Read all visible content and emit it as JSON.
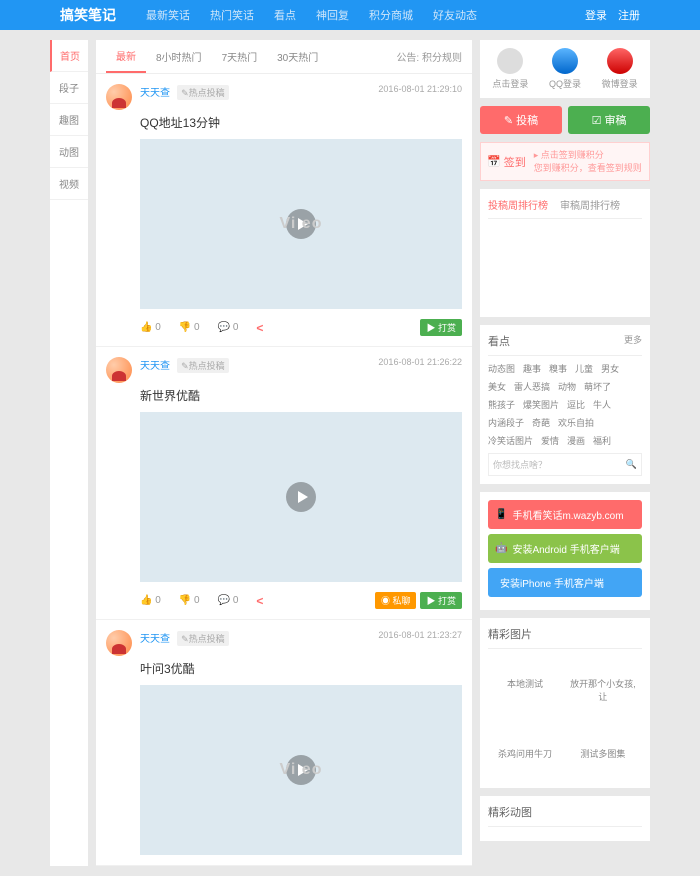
{
  "header": {
    "logo": "搞笑笔记",
    "nav": [
      "最新笑话",
      "热门笑话",
      "看点",
      "神回复",
      "积分商城",
      "好友动态"
    ],
    "login": "登录",
    "register": "注册"
  },
  "leftTabs": [
    "首页",
    "段子",
    "趣图",
    "动图",
    "视频"
  ],
  "topTabs": {
    "items": [
      "最新",
      "8小时热门",
      "7天热门",
      "30天热门"
    ],
    "noticeLabel": "公告:",
    "noticeText": "积分规则"
  },
  "posts": [
    {
      "user": "天天查",
      "tag": "✎热点投稿",
      "time": "2016-08-01 21:29:10",
      "title": "QQ地址13分钟",
      "like": "0",
      "dislike": "0",
      "comment": "0",
      "videoText": "Vi  eo",
      "buttons": [
        {
          "cls": "btn-green",
          "icon": "▶",
          "label": "打赏"
        }
      ]
    },
    {
      "user": "天天查",
      "tag": "✎热点投稿",
      "time": "2016-08-01 21:26:22",
      "title": "新世界优酷",
      "like": "0",
      "dislike": "0",
      "comment": "0",
      "videoText": "",
      "buttons": [
        {
          "cls": "btn-orange",
          "icon": "◉",
          "label": "私聊"
        },
        {
          "cls": "btn-green",
          "icon": "▶",
          "label": "打赏"
        }
      ]
    },
    {
      "user": "天天查",
      "tag": "✎热点投稿",
      "time": "2016-08-01 21:23:27",
      "title": "叶问3优酷",
      "like": "",
      "dislike": "",
      "comment": "",
      "videoText": "Vi  eo",
      "buttons": []
    }
  ],
  "sidebar": {
    "loginItems": [
      {
        "cls": "icon-user",
        "label": "点击登录"
      },
      {
        "cls": "icon-qq",
        "label": "QQ登录"
      },
      {
        "cls": "icon-weibo",
        "label": "微博登录"
      }
    ],
    "actions": {
      "post": "投稿",
      "review": "审稿"
    },
    "checkin": {
      "label": "签到",
      "line1": "▸ 点击签到赚积分",
      "line2": "您到赚积分，查看签到规则"
    },
    "rankTabs": [
      "投稿周排行榜",
      "审稿周排行榜"
    ],
    "kandian": {
      "title": "看点",
      "more": "更多",
      "tags": [
        "动态图",
        "趣事",
        "糗事",
        "儿童",
        "男女",
        "美女",
        "雷人恶搞",
        "动物",
        "萌坏了",
        "熊孩子",
        "爆笑图片",
        "逗比",
        "牛人",
        "内涵段子",
        "奇葩",
        "欢乐自拍",
        "冷笑话图片",
        "爱情",
        "漫画",
        "福利"
      ],
      "searchPlaceholder": "你想找点啥？"
    },
    "downloads": [
      {
        "cls": "dl-red",
        "icon": "📱",
        "label": "手机看笑话m.wazyb.com"
      },
      {
        "cls": "dl-green",
        "icon": "🤖",
        "label": "安装Android 手机客户端"
      },
      {
        "cls": "dl-blue",
        "icon": "",
        "label": "安装iPhone 手机客户端"
      }
    ],
    "images": {
      "title": "精彩图片",
      "items": [
        "本地测试",
        "放开那个小女孩,让",
        "杀鸡问用牛刀",
        "测试多图集"
      ]
    },
    "gif": {
      "title": "精彩动图"
    }
  }
}
